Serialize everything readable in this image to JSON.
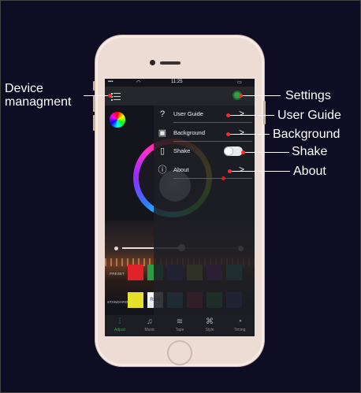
{
  "callouts": {
    "device": "Device\nmanagment",
    "settings": "Settings",
    "user_guide": "User Guide",
    "background": "Background",
    "shake": "Shake",
    "about": "About"
  },
  "status": {
    "time": "11:25"
  },
  "dropdown": {
    "items": [
      {
        "label": "User Guide",
        "icon": "question-mark-icon"
      },
      {
        "label": "Background",
        "icon": "image-icon"
      },
      {
        "label": "Shake",
        "icon": "phone-shake-icon",
        "toggle": true,
        "toggle_state": "on"
      },
      {
        "label": "About",
        "icon": "info-icon"
      }
    ]
  },
  "rows": {
    "preset_label": "PRESET",
    "standard_label": "STANDARD",
    "preset_colors": [
      "#e0232b",
      "#2f9a45",
      "#3d3f9a",
      "#b0b234",
      "#8b2f9c",
      "#2a9a8e"
    ],
    "standard_colors": [
      "#e6e02a",
      "#ffffff",
      "#2a8d98",
      "#b12a2a",
      "#2f9a45",
      "#3d3f9a"
    ],
    "rgb_label": "RGB"
  },
  "slider": {
    "value_fraction": 0.5
  },
  "tabs": [
    {
      "label": "Adjust",
      "icon": "sliders-icon",
      "active": true
    },
    {
      "label": "Music",
      "icon": "music-note-icon"
    },
    {
      "label": "Tape",
      "icon": "tape-icon"
    },
    {
      "label": "Style",
      "icon": "command-icon"
    },
    {
      "label": "Timing",
      "icon": "stopwatch-icon"
    }
  ],
  "colors": {
    "accent": "#2fa14a",
    "callout_dot": "#ff2a2a"
  }
}
